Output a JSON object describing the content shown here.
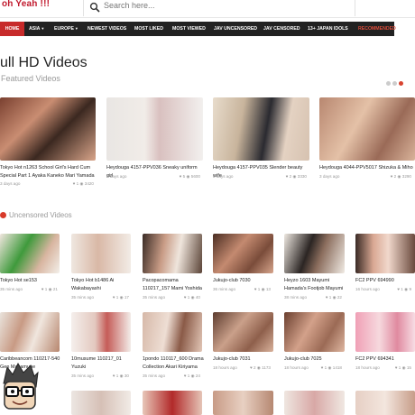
{
  "header": {
    "logo": "oh Yeah !!!",
    "search_placeholder": "Search here..."
  },
  "nav": [
    {
      "label": "Home",
      "active": true
    },
    {
      "label": "Asia",
      "caret": true
    },
    {
      "label": "Europe",
      "caret": true
    },
    {
      "label": "Newest Videos"
    },
    {
      "label": "Most Liked"
    },
    {
      "label": "Most Viewed"
    },
    {
      "label": "JAV Uncensored"
    },
    {
      "label": "JAV Censored"
    },
    {
      "label": "13+ Japan Idols"
    },
    {
      "label": "Recommended"
    }
  ],
  "page": {
    "heading": "ull HD Videos",
    "subheading": "Featured Videos"
  },
  "featured": [
    {
      "title": "Tokyo Hot n1263 School Girl's Hard Cum Special Part 1 Ayaka Kaneko Mari Yamada",
      "ago": "3 days ago",
      "likes": "1",
      "views": "3420"
    },
    {
      "title": "Heydouga 4157-PPV036 Sneaky uniform girl",
      "ago": "3 days ago",
      "likes": "5",
      "views": "5600"
    },
    {
      "title": "Heydouga 4157-PPV035 Slender beauty wife",
      "ago": "3 days ago",
      "likes": "2",
      "views": "3330"
    },
    {
      "title": "Heydouga 4044-PPV5017 Shizuka & Miho",
      "ago": "3 days ago",
      "likes": "2",
      "views": "3290"
    }
  ],
  "uncensored": {
    "heading": "Uncensored Videos",
    "row1": [
      {
        "title": "Tokyo Hot se153",
        "ago": "35 mins ago",
        "likes": "1",
        "views": "21"
      },
      {
        "title": "Tokyo Hot b1486 Ai Wakabayashi",
        "ago": "35 mins ago",
        "likes": "1",
        "views": "17"
      },
      {
        "title": "Pacopacomama 110217_157 Mami Yoshida",
        "ago": "35 mins ago",
        "likes": "1",
        "views": "40"
      },
      {
        "title": "Jukujo-club 7030",
        "ago": "36 mins ago",
        "likes": "1",
        "views": "13"
      },
      {
        "title": "Heyzo 1603 Mayumi Hamada's Footjob Mayumi",
        "ago": "38 mins ago",
        "likes": "1",
        "views": "22"
      },
      {
        "title": "FC2 PPV 694990",
        "ago": "16 hours ago",
        "likes": "1",
        "views": "9"
      }
    ],
    "row2": [
      {
        "title": "Caribbeancom 110217-540 Gen Masamune",
        "ago": "35 mins ago",
        "likes": "1",
        "views": "14"
      },
      {
        "title": "10musume 110217_01 Yuzuki",
        "ago": "35 mins ago",
        "likes": "1",
        "views": "30"
      },
      {
        "title": "1pondo 110117_600 Drama Collection Akari Kiriyama",
        "ago": "35 mins ago",
        "likes": "1",
        "views": "24"
      },
      {
        "title": "Jukujo-club 7031",
        "ago": "18 hours ago",
        "likes": "2",
        "views": "1173"
      },
      {
        "title": "Jukujo-club 7025",
        "ago": "18 hours ago",
        "likes": "1",
        "views": "1418"
      },
      {
        "title": "FC2 PPV 694341",
        "ago": "18 hours ago",
        "likes": "1",
        "views": "15"
      }
    ]
  },
  "icons": [
    "search-icon",
    "heart-icon",
    "eye-icon",
    "fire-icon",
    "nerd-avatar-icon"
  ],
  "colors": {
    "brand": "#c0182c",
    "nav_bg": "#222222",
    "nav_active": "#c72a2a",
    "dot_active": "#d8432f"
  }
}
